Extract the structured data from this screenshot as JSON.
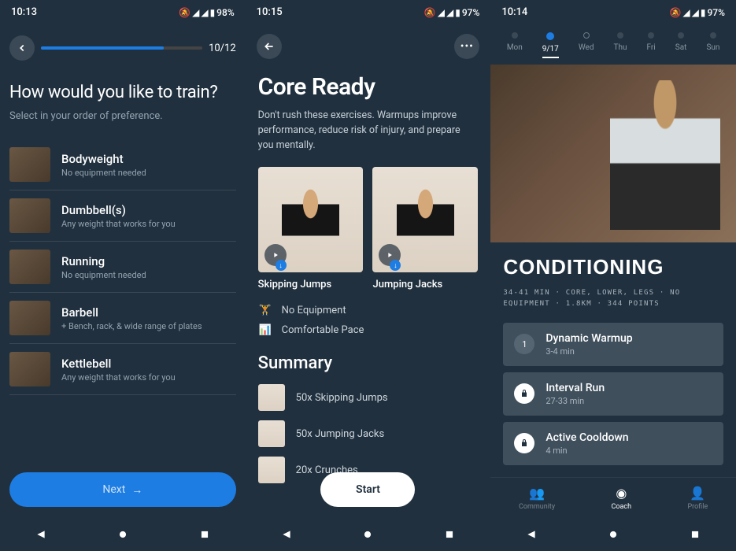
{
  "screen1": {
    "time": "10:13",
    "battery": "98%",
    "progress_current": 10,
    "progress_total": 12,
    "progress_label": "10/12",
    "title": "How would you like to train?",
    "subtitle": "Select in your order of preference.",
    "items": [
      {
        "name": "Bodyweight",
        "desc": "No equipment needed"
      },
      {
        "name": "Dumbbell(s)",
        "desc": "Any weight that works for you"
      },
      {
        "name": "Running",
        "desc": "No equipment needed"
      },
      {
        "name": "Barbell",
        "desc": "+ Bench, rack, & wide range of plates"
      },
      {
        "name": "Kettlebell",
        "desc": "Any weight that works for you"
      }
    ],
    "next_label": "Next"
  },
  "screen2": {
    "time": "10:15",
    "battery": "97%",
    "title": "Core Ready",
    "desc": "Don't rush these exercises. Warmups improve performance, reduce risk of injury, and prepare you mentally.",
    "exercises": [
      {
        "name": "Skipping Jumps"
      },
      {
        "name": "Jumping Jacks"
      }
    ],
    "meta_equipment": "No Equipment",
    "meta_pace": "Comfortable Pace",
    "summary_title": "Summary",
    "summary": [
      {
        "text": "50x Skipping Jumps"
      },
      {
        "text": "50x Jumping Jacks"
      },
      {
        "text": "20x Crunches"
      }
    ],
    "start_label": "Start"
  },
  "screen3": {
    "time": "10:14",
    "battery": "97%",
    "days": [
      {
        "label": "Mon",
        "state": "done"
      },
      {
        "label": "9/17",
        "state": "active"
      },
      {
        "label": "Wed",
        "state": "ring"
      },
      {
        "label": "Thu",
        "state": "dot"
      },
      {
        "label": "Fri",
        "state": "dot"
      },
      {
        "label": "Sat",
        "state": "dot"
      },
      {
        "label": "Sun",
        "state": "dot"
      }
    ],
    "title": "CONDITIONING",
    "meta": "34-41 MIN · CORE, LOWER, LEGS · NO EQUIPMENT · 1.8KM · 344 POINTS",
    "workouts": [
      {
        "badge": "1",
        "name": "Dynamic Warmup",
        "dur": "3-4 min",
        "locked": false
      },
      {
        "badge": "lock",
        "name": "Interval Run",
        "dur": "27-33 min",
        "locked": true
      },
      {
        "badge": "lock",
        "name": "Active Cooldown",
        "dur": "4 min",
        "locked": true
      }
    ],
    "tabs": [
      {
        "label": "Community",
        "icon": "community"
      },
      {
        "label": "Coach",
        "icon": "coach",
        "active": true
      },
      {
        "label": "Profile",
        "icon": "profile"
      }
    ]
  }
}
